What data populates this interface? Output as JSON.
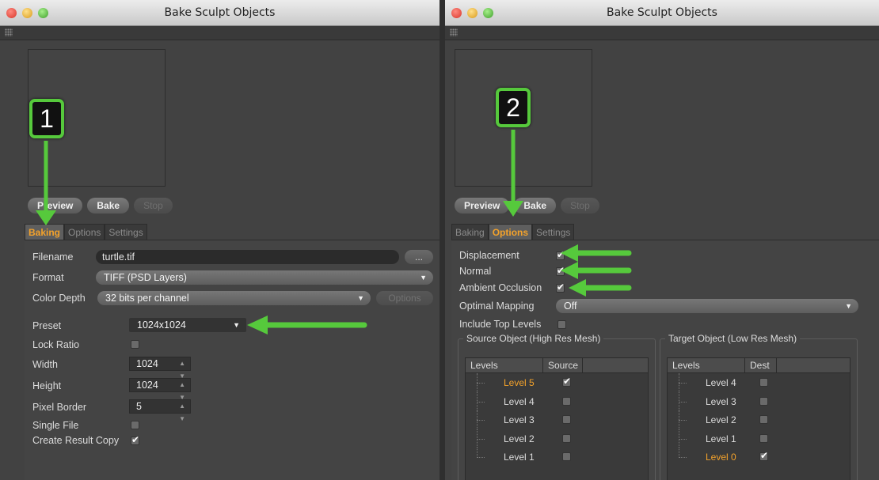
{
  "left": {
    "title": "Bake Sculpt Objects",
    "buttons": {
      "preview": "Preview",
      "bake": "Bake",
      "stop": "Stop"
    },
    "tabs": [
      "Baking",
      "Options",
      "Settings"
    ],
    "badge": "1",
    "baking": {
      "filename_label": "Filename",
      "filename_value": "turtle.tif",
      "browse": "...",
      "format_label": "Format",
      "format_value": "TIFF (PSD Layers)",
      "depth_label": "Color Depth",
      "depth_value": "32 bits per channel",
      "options_button": "Options",
      "preset_label": "Preset",
      "preset_value": "1024x1024",
      "lock_label": "Lock Ratio",
      "width_label": "Width",
      "width_value": "1024",
      "height_label": "Height",
      "height_value": "1024",
      "border_label": "Pixel Border",
      "border_value": "5",
      "single_label": "Single File",
      "copy_label": "Create Result Copy"
    }
  },
  "right": {
    "title": "Bake Sculpt Objects",
    "buttons": {
      "preview": "Preview",
      "bake": "Bake",
      "stop": "Stop"
    },
    "tabs": [
      "Baking",
      "Options",
      "Settings"
    ],
    "badge": "2",
    "options": {
      "displacement": "Displacement",
      "normal": "Normal",
      "ao": "Ambient Occlusion",
      "mapping_label": "Optimal Mapping",
      "mapping_value": "Off",
      "include": "Include Top Levels",
      "source": {
        "title": "Source Object (High Res Mesh)",
        "col1": "Levels",
        "col2": "Source",
        "rows": [
          "Level 5",
          "Level 4",
          "Level 3",
          "Level 2",
          "Level 1"
        ]
      },
      "target": {
        "title": "Target Object (Low Res Mesh)",
        "col1": "Levels",
        "col2": "Dest",
        "rows": [
          "Level 4",
          "Level 3",
          "Level 2",
          "Level 1",
          "Level 0"
        ]
      }
    }
  },
  "colors": {
    "accent": "#f3a22b",
    "callout": "#56c93c"
  }
}
